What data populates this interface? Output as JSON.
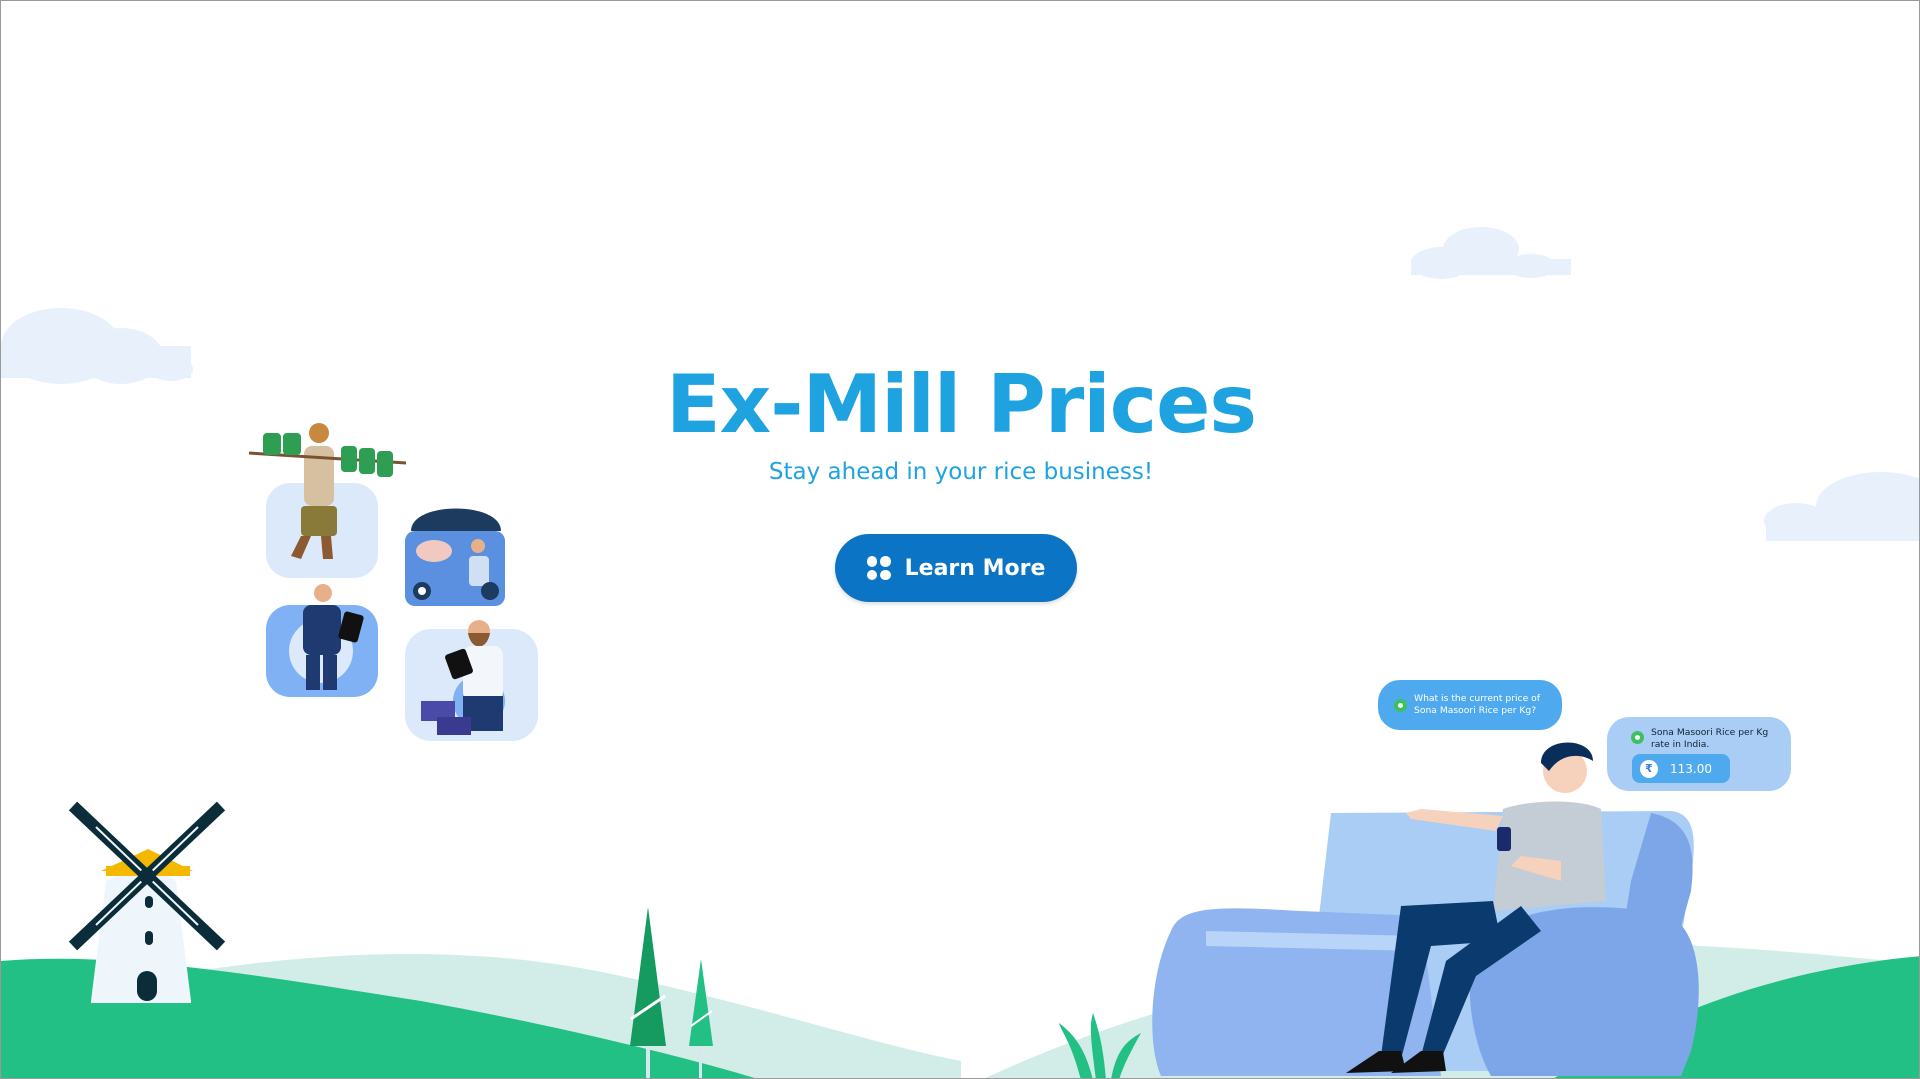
{
  "hero": {
    "title": "Ex-Mill Prices",
    "subtitle": "Stay ahead in your rice business!",
    "cta_label": "Learn More"
  },
  "chat": {
    "question": "What is the current price of Sona Masoori Rice per Kg?",
    "answer_label": "Sona Masoori Rice per Kg rate in India.",
    "currency_symbol": "₹",
    "price": "113.00"
  },
  "icons": {
    "cta": "grid-dots-icon",
    "message": "whatsapp-icon",
    "currency": "rupee-icon"
  },
  "colors": {
    "title": "#1fa3e0",
    "subtitle": "#1fa3e0",
    "button": "#0b74c4",
    "hill_dark": "#22c085",
    "hill_light": "#d2ede7",
    "cloud": "#e8f1fb",
    "bubble_blue": "#4fa9ef",
    "bubble_light": "#a9cdf5",
    "sofa": "#8fb4f0"
  }
}
